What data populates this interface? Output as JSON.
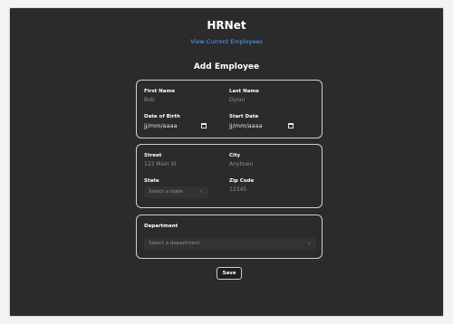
{
  "app": {
    "title": "HRNet",
    "nav_link": "View Current Employees",
    "page_title": "Add Employee"
  },
  "form": {
    "personal": {
      "first_name_label": "First Name",
      "first_name_placeholder": "Bob",
      "last_name_label": "Last Name",
      "last_name_placeholder": "Dylan",
      "dob_label": "Date of Birth",
      "dob_value": "jj/mm/aaaa",
      "start_label": "Start Date",
      "start_value": "jj/mm/aaaa"
    },
    "address": {
      "street_label": "Street",
      "street_placeholder": "123 Main St",
      "city_label": "City",
      "city_placeholder": "Anytown",
      "state_label": "State",
      "state_placeholder": "Select a state",
      "zip_label": "Zip Code",
      "zip_placeholder": "12345"
    },
    "department": {
      "label": "Department",
      "placeholder": "Select a department"
    },
    "save_label": "Save"
  },
  "icons": {
    "calendar": "calendar-icon",
    "chevron": "chevron-down-icon"
  },
  "colors": {
    "background": "#2b2b2b",
    "link": "#4aa3ff",
    "text": "#ffffff",
    "placeholder": "#8f8f8f"
  }
}
